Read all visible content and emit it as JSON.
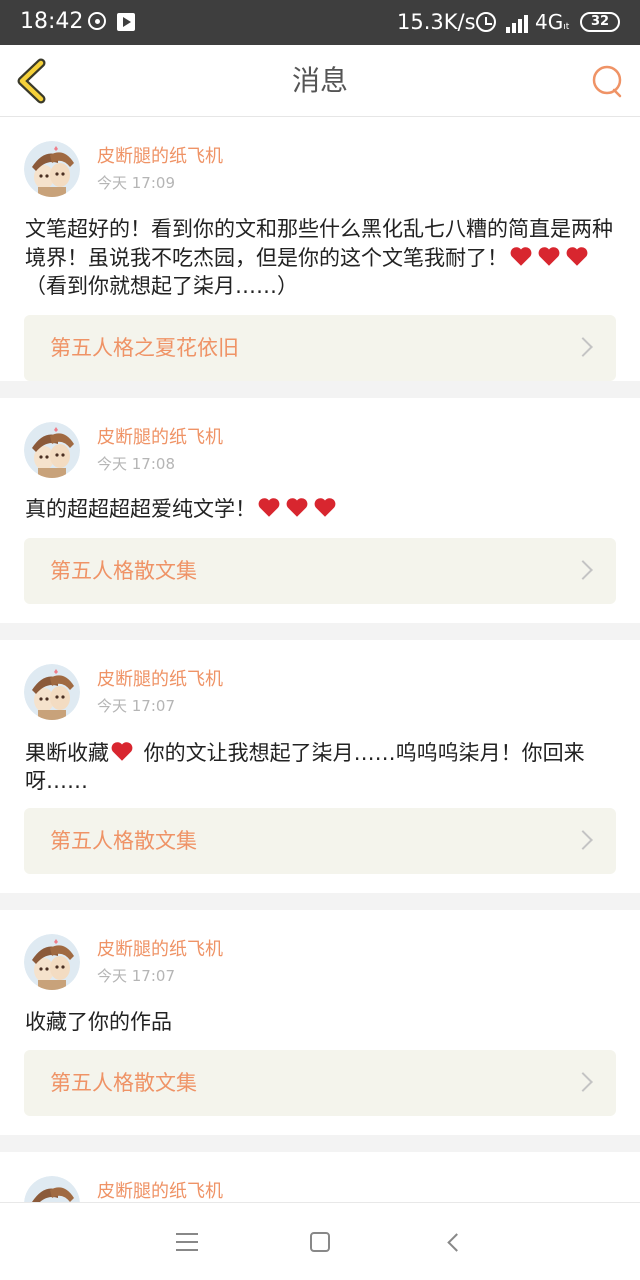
{
  "status_bar": {
    "time": "18:42",
    "net_speed": "15.3K/s",
    "network": "4G",
    "network_sub": "ıt",
    "battery": "32",
    "icons": [
      "notification-icon",
      "play-store-icon",
      "alarm-icon",
      "signal-icon",
      "battery-icon"
    ]
  },
  "header": {
    "title": "消息",
    "back_icon": "chevron-left-icon",
    "search_icon": "search-icon"
  },
  "messages": [
    {
      "author": "皮断腿的纸飞机",
      "time": "今天 17:09",
      "content_pre": "文笔超好的！看到你的文和那些什么黑化乱七八糟的简直是两种境界！虽说我不吃杰园，但是你的这个文笔我耐了！",
      "content_post": "（看到你就想起了柒月……）",
      "hearts": 3,
      "work": "第五人格之夏花依旧"
    },
    {
      "author": "皮断腿的纸飞机",
      "time": "今天 17:08",
      "content_pre": "真的超超超超爱纯文学！",
      "content_post": "",
      "hearts": 3,
      "work": "第五人格散文集"
    },
    {
      "author": "皮断腿的纸飞机",
      "time": "今天 17:07",
      "content_pre": "果断收藏",
      "content_post": " 你的文让我想起了柒月……呜呜呜柒月！你回来呀……",
      "hearts": 1,
      "work": "第五人格散文集"
    },
    {
      "author": "皮断腿的纸飞机",
      "time": "今天 17:07",
      "content_pre": "收藏了你的作品",
      "content_post": "",
      "hearts": 0,
      "work": "第五人格散文集"
    },
    {
      "author": "皮断腿的纸飞机",
      "time": "",
      "content_pre": "",
      "content_post": "",
      "hearts": 0,
      "work": ""
    }
  ],
  "colors": {
    "accent": "#ef9366",
    "status_bar": "#3e3e3e",
    "link_bg": "#f4f4ec",
    "heart": "#d8262f"
  },
  "nav_bar": {
    "icons": [
      "menu-icon",
      "home-icon",
      "back-icon"
    ]
  }
}
